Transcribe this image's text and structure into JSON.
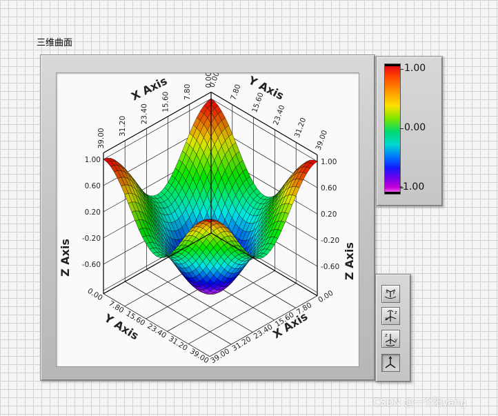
{
  "control": {
    "label": "三维曲面"
  },
  "graph": {
    "x_axis_title": "X Axis",
    "y_axis_title": "Y Axis",
    "z_axis_title": "Z Axis",
    "x_ticks": [
      "0.00",
      "7.80",
      "15.60",
      "23.40",
      "31.20",
      "39.00"
    ],
    "y_ticks": [
      "0.00",
      "7.80",
      "15.60",
      "23.40",
      "31.20",
      "39.00"
    ],
    "z_ticks": [
      "1.00",
      "0.60",
      "0.20",
      "-0.20",
      "-0.60"
    ],
    "colormap": "hue rainbow (red high, magenta low)"
  },
  "legend": {
    "labels": [
      "1.00",
      "0.00",
      "-1.00"
    ],
    "colors": {
      "high": "#d8001b",
      "mid": "#7ce600",
      "low": "#ff7cff"
    }
  },
  "toolbar": {
    "buttons": [
      {
        "name": "rotate-xy-plane-icon"
      },
      {
        "name": "rotate-xz-icon"
      },
      {
        "name": "rotate-zy-icon"
      },
      {
        "name": "default-view-icon"
      }
    ]
  },
  "watermark": {
    "text": "CSDN @一个阳yang"
  }
}
